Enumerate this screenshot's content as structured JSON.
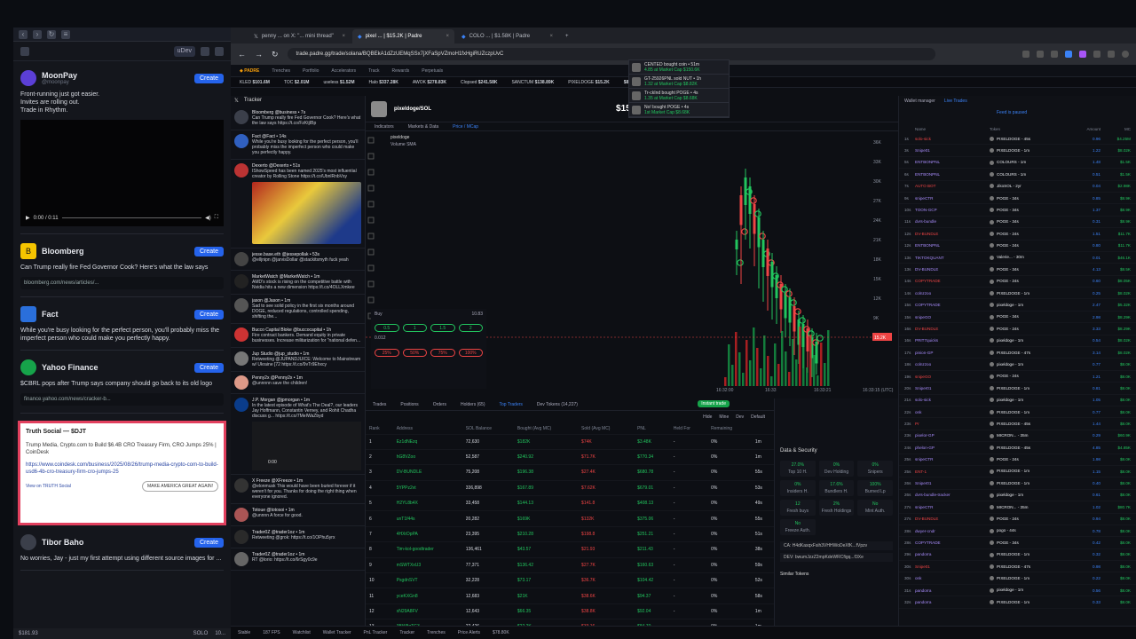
{
  "colors": {
    "accent": "#2563eb",
    "green": "#22c55e",
    "red": "#ef4444",
    "truth_border": "#e2405e"
  },
  "left": {
    "toolbar": {
      "chip": "uDev"
    },
    "cards": [
      {
        "name": "MoonPay",
        "handle": "@moonpay",
        "text": "Front-running just got easier.\nInvites are rolling out.\nTrade in Rhythm.",
        "video_time": "0:00 / 0:11"
      },
      {
        "name": "Bloomberg",
        "text": "Can Trump really fire Fed Governor Cook? Here's what the law says",
        "link": "bloomberg.com/news/articles/..."
      },
      {
        "name": "Fact",
        "text": "While you're busy looking for the perfect person, you'll probably miss the imperfect person who could make you perfectly happy."
      },
      {
        "name": "Yahoo Finance",
        "text": "$CBRL pops after Trump says company should go back to its old logo",
        "link": "finance.yahoo.com/news/cracker-b..."
      }
    ],
    "truth": {
      "head": "Truth Social — $DJT",
      "body": "Trump Media, Crypto.com to Build $6.4B CRO Treasury Firm, CRO Jumps 25% | CoinDesk",
      "link": "https://www.coindesk.com/business/2025/08/26/trump-media-crypto-com-to-build-usd6-4b-cro-treasury-firm-cro-jumps-25",
      "view": "View on TRUTH Social",
      "btn": "MAKE AMERICA GREAT AGAIN!"
    },
    "last": {
      "name": "Tibor Baho",
      "text": "No worries, Jay - just my first attempt using different source images for ..."
    },
    "bottom": {
      "price": "$181.93",
      "ticker": "SOLO",
      "extra": "10..."
    },
    "create_label": "Create"
  },
  "browser": {
    "tabs": [
      {
        "label": "penny ... on X: \"... mini thread\""
      },
      {
        "label": "pixel ... | $15.2K | Padre"
      },
      {
        "label": "COLO ... | $1.58K | Padre"
      }
    ],
    "url": "trade.padre.gg/trade/solana/BQBEkA1dZzUEMqSSx7jXFaSpVZmoH1fxHgiRUZczpUvC"
  },
  "appnav": [
    "Trenches",
    "Portfolio",
    "Accelerators",
    "Track",
    "Rewards",
    "Perpetuals"
  ],
  "ticker": [
    {
      "k": "KLED",
      "v": "$101.6M"
    },
    {
      "k": "TOC",
      "v": "$2.01M"
    },
    {
      "k": "useless",
      "v": "$1.52M"
    },
    {
      "k": "Halo",
      "v": "$337.28K"
    },
    {
      "k": "AWOK",
      "v": "$278.83K"
    },
    {
      "k": "Clopsed",
      "v": "$241.58K"
    },
    {
      "k": "SANCTUM",
      "v": "$138.89K"
    },
    {
      "k": "PIXELDOGE",
      "v": "$15.2K"
    },
    {
      "k": "",
      "v": "$8.03K"
    }
  ],
  "tracker": {
    "title": "Tracker",
    "tweets": [
      {
        "name": "Bloomberg @business • 7s",
        "text": "Can Trump really fire Fed Governor Cook? Here's what the law says https://t.co/FzKtjIBp"
      },
      {
        "name": "Fact @Fact • 14s",
        "text": "While you're busy looking for the perfect person, you'll probably miss the imperfect person who could make you perfectly happy."
      },
      {
        "name": "Dexerto @Dexerto • 51s",
        "text": "IShowSpeed has been named 2025's most influential creator by Rolling Stone https://t.co/UbnlRnbVsy"
      },
      {
        "name": "jesse.base.eth @jessepollak • 53s",
        "text": "@elljnipn @jarvisDollar @stackitsmyth fuck yeah"
      },
      {
        "name": "MarketWatch @MarketWatch • 1m",
        "text": "AMD's stock is rising on the competitive battle with Nvidia hits a new dimension https://t.co/4OLLXmkee"
      },
      {
        "name": "jason @Jason • 1m",
        "text": "Sad to see solid policy in the first six months around DOGE, reduced regulations, controlled spending, shifting the..."
      },
      {
        "name": "Bucco Capital Bloke @buccocapital • 1h",
        "text": "Fire contract bankers. Demand equity in private businesses. Increase militarization for \"national defen..."
      },
      {
        "name": "Jup Studio @jup_studio • 1m",
        "text": "Retweeting @JUPANDJUICE: Welcome to Mainstream w/ Ukraine [72 https://t.co/9vTr9Ehxcy"
      },
      {
        "name": "Penny2x @Penny2x • 1m",
        "text": "@unnnnn save the children!"
      },
      {
        "name": "J.P. Morgan @jpmorgan • 1m",
        "text": "In the latest episode of What's The Deal?, our leaders Jay Hoffmann, Constantin Verney, and Rohit Chadha discuss g... https://t.co/7MeIWaZbyd",
        "video": "0:00"
      },
      {
        "name": "X Freeze @XFreeze • 1m",
        "text": "@elonmusk This would have been buried forever if it weren't for you. Thanks for doing the right thing when everyone ignored."
      },
      {
        "name": "Totoue @totosoi • 1m",
        "text": "@unnnn A force for good."
      },
      {
        "name": "Trader0Z @trader1oz • 1m",
        "text": "Retweeting @grok: https://t.co/1OPhu5yrx"
      },
      {
        "name": "Trader0Z @trader1oz • 1m",
        "text": "RT @lorio: https://t.co/6rSgy0c9e"
      }
    ]
  },
  "chart": {
    "token": "pixeldoge/SOL",
    "mc": "$15.2K",
    "tools": [
      "Indicators",
      "Markets & Data",
      "Price / MCap"
    ],
    "legend": "pixeldoge",
    "volume": "Volume SMA",
    "times": [
      "16:32:00",
      "16:33",
      "16:33:21",
      "16:33:15 (UTC)"
    ],
    "axis": [
      "36K",
      "33K",
      "30K",
      "27K",
      "24K",
      "21K",
      "18K",
      "15K",
      "12K",
      "9K",
      "6K"
    ],
    "price_label": "15.2K",
    "notifs": [
      {
        "t": "CENTED bought coin • 51m",
        "s": "4.85 at Market Cap $150.6K"
      },
      {
        "t": "GT-25926PNL sold NUT • 1h",
        "s": "1.32 at Market Cap $8.82K"
      },
      {
        "t": "Tr-ckInd bought POGE • 4s",
        "s": "1.35 at Market Cap $8.68K"
      },
      {
        "t": "No! bought POGE • 4s",
        "s": "1st Market Cap $8.68K"
      }
    ],
    "buy": {
      "amounts": [
        "0.5",
        "1",
        "1.5",
        "2"
      ],
      "sells": [
        "25%",
        "50%",
        "75%",
        "100%"
      ],
      "sol": "10.83",
      "field": "0.012"
    }
  },
  "table": {
    "tabs": [
      "Trades",
      "Positions",
      "Orders",
      "Holders (65)",
      "Top Traders",
      "Dev Tokens (14,227)"
    ],
    "instant": "Instant trade",
    "filters": [
      "Hide",
      "Mine",
      "Dev",
      "Default"
    ],
    "headers": [
      "Rank",
      "Address",
      "SOL Balance",
      "Bought (Avg MC)",
      "Sold (Avg MC)",
      "PNL",
      "Held For",
      "Remaining",
      ""
    ],
    "rows": [
      [
        "1",
        "Ez1dNEzq",
        "72,630",
        "$182K",
        "$74K",
        "$3.48K",
        "-",
        "0%",
        "1m"
      ],
      [
        "2",
        "hG8VZoo",
        "52,587",
        "$240.92",
        "$71.7K",
        "$770.34",
        "-",
        "0%",
        "1m"
      ],
      [
        "3",
        "DV-BUNDLE",
        "75,208",
        "$196.38",
        "$27.4K",
        "$680.78",
        "-",
        "0%",
        "55s"
      ],
      [
        "4",
        "5YPPz2vt",
        "336,898",
        "$167.89",
        "$7.62K",
        "$679.01",
        "-",
        "0%",
        "53s"
      ],
      [
        "5",
        "H2YL8b4X",
        "33,458",
        "$144.13",
        "$141.8",
        "$408.13",
        "-",
        "0%",
        "49s"
      ],
      [
        "6",
        "unT1f44s",
        "20,282",
        "$169K",
        "$132K",
        "$375.06",
        "-",
        "0%",
        "55s"
      ],
      [
        "7",
        "4HXrDpPA",
        "23,395",
        "$210.28",
        "$198.8",
        "$251.21",
        "-",
        "0%",
        "51s"
      ],
      [
        "8",
        "Tim-kol-goodtrader",
        "136,461",
        "$43.57",
        "$21.93",
        "$211.43",
        "-",
        "0%",
        "38s"
      ],
      [
        "9",
        "mSWTXxU3",
        "77,371",
        "$136.42",
        "$27.7K",
        "$160.63",
        "-",
        "0%",
        "59s"
      ],
      [
        "10",
        "PsgdnSVT",
        "32,228",
        "$73.17",
        "$36.7K",
        "$104.42",
        "-",
        "0%",
        "52s"
      ],
      [
        "11",
        "yceKXGn8",
        "12,683",
        "$21K",
        "$38.6K",
        "$94.37",
        "-",
        "0%",
        "58s"
      ],
      [
        "12",
        "xN29A8FV",
        "12,643",
        "$66.35",
        "$38.8K",
        "$92.04",
        "-",
        "0%",
        "1m"
      ],
      [
        "13",
        "3BW8gTG3",
        "22,426",
        "$22.2K",
        "$33.16",
        "$84.70",
        "-",
        "0%",
        "1m"
      ],
      [
        "14",
        "FvbfWFUN",
        "4,583",
        "$99.82",
        "$19.6K",
        "$74.33",
        "-",
        "0%",
        "40s"
      ]
    ]
  },
  "ds": {
    "title": "Data & Security",
    "cells": [
      {
        "v": "27.0%",
        "l": "Top 10 H."
      },
      {
        "v": "0%",
        "l": "Dev Holding"
      },
      {
        "v": "0%",
        "l": "Snipers"
      },
      {
        "v": "0%",
        "l": "Insiders H."
      },
      {
        "v": "17.6%",
        "l": "Bundlers H."
      },
      {
        "v": "100%",
        "l": "Burned Lp"
      },
      {
        "v": "12",
        "l": "Fresh buys"
      },
      {
        "v": "2%",
        "l": "Fresh Holdings"
      },
      {
        "v": "No",
        "l": "Mint Auth."
      },
      {
        "v": "No",
        "l": "Freeze Auth."
      }
    ],
    "ca": "CA: H4dKasqxFsih3VHHWoDeXfK...fVpzv",
    "dev": "DEV: bwumJzzZ2mpKdeWRCfigq...f3Xe",
    "similar": "Similar Tokens"
  },
  "wallet": {
    "tabs": [
      "Wallet manager",
      "Live Trades"
    ],
    "paused": "Feed is paused",
    "cols": [
      "",
      "Name",
      "Token",
      "Amount",
      "MC"
    ],
    "rows": [
      [
        "1s",
        "solo-sick",
        "PIXELDOGE - 45s",
        "0.96",
        "$4.25M"
      ],
      [
        "3s",
        "Snipe01",
        "PIXELDOGE - 1m",
        "1.22",
        "$8.02K"
      ],
      [
        "5s",
        "ENTBONPNL",
        "COLOURS - 1m",
        "1.48",
        "$1.5K"
      ],
      [
        "6s",
        "ENTBONPNL",
        "COLOURS - 1m",
        "0.51",
        "$1.5K"
      ],
      [
        "7s",
        "AUTO BOT",
        "JikoSOL - 2yr",
        "0.04",
        "$2.98K"
      ],
      [
        "9s",
        "snipeCTR",
        "POGE - 34s",
        "0.85",
        "$8.9K"
      ],
      [
        "10s",
        "TOON-GCP",
        "POGE - 34s",
        "1.37",
        "$8.9K"
      ],
      [
        "11s",
        "dvrs-bundle",
        "POGE - 34s",
        "0.31",
        "$8.9K"
      ],
      [
        "12s",
        "DV-BUNDLE",
        "POGE - 24s",
        "1.51",
        "$11.7K"
      ],
      [
        "12s",
        "ENTBONPNL",
        "POGE - 24s",
        "0.80",
        "$11.7K"
      ],
      [
        "13s",
        "TIKTOKQUANT",
        "Valerie... - 30m",
        "0.01",
        "$46.1K"
      ],
      [
        "13s",
        "DV-BUNDLE",
        "POGE - 34s",
        "4.13",
        "$8.5K"
      ],
      [
        "14s",
        "COPYTRADE",
        "POGE - 24s",
        "0.60",
        "$8.05K"
      ],
      [
        "14s",
        "colnzzoo",
        "PIXELDOGE - 1m",
        "0.25",
        "$8.02K"
      ],
      [
        "15s",
        "COPYTRADE",
        "pixeldoge - 1m",
        "2.47",
        "$5.32K"
      ],
      [
        "15s",
        "snipeGO",
        "POGE - 34s",
        "2.98",
        "$8.29K"
      ],
      [
        "16s",
        "DV-BUNDLE",
        "POGE - 24s",
        "3.33",
        "$8.29K"
      ],
      [
        "16s",
        "PRIT7quicks",
        "pixeldoge - 1m",
        "0.54",
        "$8.02K"
      ],
      [
        "17s",
        "pinion-GP",
        "PIXELDOGE - 47s",
        "3.14",
        "$8.02K"
      ],
      [
        "18s",
        "colnzzoo",
        "pixeldoge - 1m",
        "0.77",
        "$8.0K"
      ],
      [
        "19s",
        "snipeGO",
        "POGE - 24s",
        "1.21",
        "$8.0K"
      ],
      [
        "20s",
        "Sniper01",
        "PIXELDOGE - 1m",
        "0.81",
        "$8.0K"
      ],
      [
        "21s",
        "solo-sick",
        "pixeldoge - 1m",
        "1.05",
        "$8.0K"
      ],
      [
        "22s",
        "onk",
        "PIXELDOGE - 1m",
        "0.77",
        "$8.0K"
      ],
      [
        "23s",
        "Pr",
        "PIXELDOGE - 45s",
        "1.44",
        "$8.0K"
      ],
      [
        "23s",
        "pixelor-GP",
        "MICRON... - 35m",
        "0.29",
        "$60.9K"
      ],
      [
        "24s",
        "phelon-GP",
        "PIXELDOGE - 45s",
        "4.85",
        "$4.85K"
      ],
      [
        "25s",
        "snipeCTR",
        "POGE - 24s",
        "1.98",
        "$8.0K"
      ],
      [
        "25s",
        "ENT-1",
        "PIXELDOGE - 1m",
        "1.15",
        "$8.0K"
      ],
      [
        "26s",
        "Sniper01",
        "PIXELDOGE - 1m",
        "0.40",
        "$8.0K"
      ],
      [
        "26s",
        "dvrs-bundle-tracker",
        "pixeldoge - 1m",
        "0.61",
        "$8.0K"
      ],
      [
        "27s",
        "snipeCTR",
        "MICRON... - 35m",
        "1.02",
        "$80.7K"
      ],
      [
        "27s",
        "DV-BUNDLE",
        "POGE - 24s",
        "0.94",
        "$8.0K"
      ],
      [
        "28s",
        "dwyer-cndr",
        "pogo - 44s",
        "0.78",
        "$8.0K"
      ],
      [
        "28s",
        "COPYTRADE",
        "POGE - 34s",
        "0.42",
        "$8.0K"
      ],
      [
        "29s",
        "pandorra",
        "PIXELDOGE - 1m",
        "0.32",
        "$8.0K"
      ],
      [
        "30s",
        "Snipe01",
        "PIXELDOGE - 47s",
        "0.98",
        "$8.0K"
      ],
      [
        "30s",
        "onk",
        "PIXELDOGE - 1m",
        "0.22",
        "$8.0K"
      ],
      [
        "31s",
        "pandorra",
        "pixeldoge - 1m",
        "0.56",
        "$8.0K"
      ],
      [
        "32s",
        "pandorra",
        "PIXELDOGE - 1m",
        "0.33",
        "$8.0K"
      ]
    ]
  },
  "statusbar": [
    "Stable",
    "187 FPS",
    "Watchlist",
    "Wallet Tracker",
    "PnL Tracker",
    "Tracker",
    "Trenches",
    "Price Alerts",
    "$78.80K"
  ]
}
